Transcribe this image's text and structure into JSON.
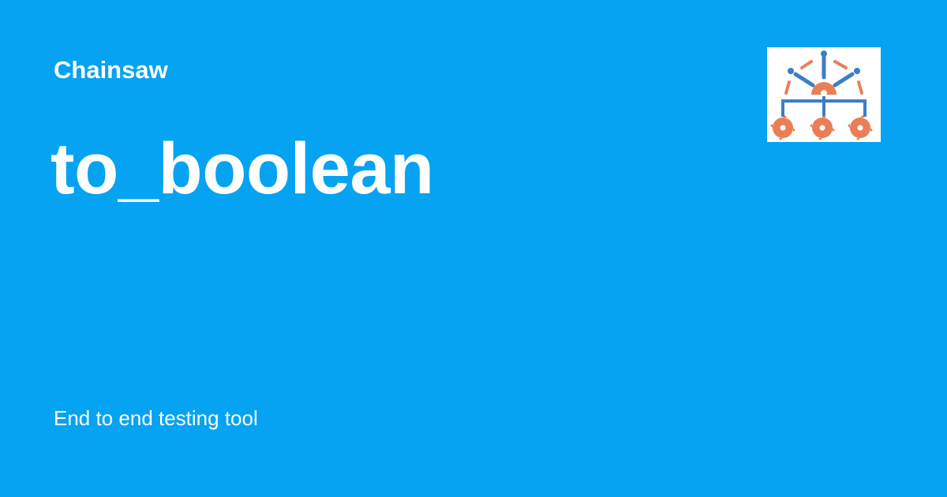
{
  "header": {
    "site_name": "Chainsaw"
  },
  "main": {
    "title": "to_boolean"
  },
  "footer": {
    "tagline": "End to end testing tool"
  },
  "logo": {
    "icon": "chainsaw-logo-icon",
    "colors": {
      "blue": "#3b7fc4",
      "orange": "#ea7e56",
      "background": "#ffffff"
    }
  },
  "theme": {
    "background": "#05a3f2",
    "text": "#ffffff"
  }
}
